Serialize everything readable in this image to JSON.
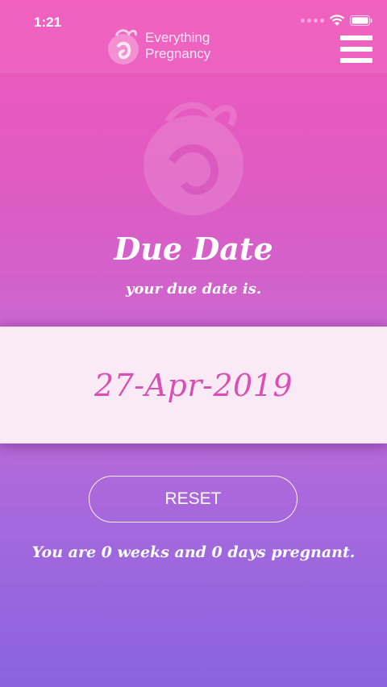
{
  "status_bar": {
    "time": "1:21",
    "icons": [
      "signal-dots-icon",
      "wifi-icon",
      "battery-icon"
    ]
  },
  "header": {
    "brand_line1": "Everything",
    "brand_line2": "Pregnancy",
    "logo_icon": "pregnancy-logo-icon",
    "menu_icon": "hamburger-menu-icon"
  },
  "main": {
    "title": "Due Date",
    "subtitle": "your due date is.",
    "due_date": "27-Apr-2019",
    "reset_label": "RESET",
    "pregnancy_status": "You are 0 weeks and 0 days pregnant."
  },
  "colors": {
    "gradient_top": "#f258bb",
    "gradient_bottom": "#8a63e0",
    "card_background": "#f9eaf6",
    "date_text": "#d94fb4"
  }
}
